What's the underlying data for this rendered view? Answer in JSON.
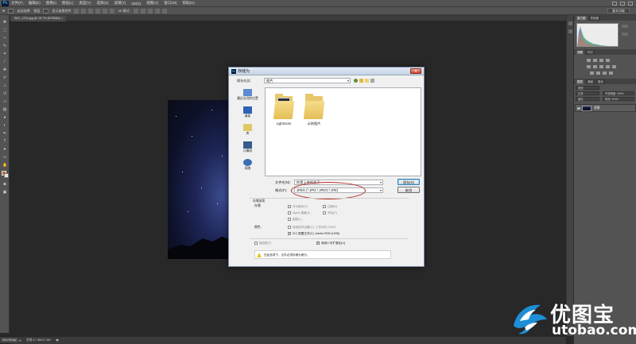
{
  "app": {
    "logo": "Ps",
    "menu": [
      "文件(F)",
      "编辑(E)",
      "图像(I)",
      "图层(L)",
      "类型(Y)",
      "选择(S)",
      "滤镜(T)",
      "3D(D)",
      "视图(V)",
      "窗口(W)",
      "帮助(H)"
    ],
    "options": {
      "auto_select": "自动选择:",
      "layer": "图层",
      "show_transform": "显示变换控件",
      "mode_3d": "3D 模式:",
      "workspace": "基本功能"
    },
    "doc_tab": "IMG_1234.jpg @ 16.7% (RGB/8#) ×"
  },
  "status": {
    "zoom": "16.67%",
    "doc": "文档:17.3M/17.3M",
    "mini_bridge": "Mini Bridge",
    "timeline": "时间轴"
  },
  "right_panel": {
    "tabs_top": [
      "直方图",
      "导航器"
    ],
    "tabs_mid": [
      "调整",
      "样式"
    ],
    "tabs_layers": [
      "图层",
      "通道",
      "路径"
    ],
    "layer_kind": "类型",
    "blend_mode": "正常",
    "opacity": "不透明度: 100%",
    "lock": "锁定:",
    "fill": "填充: 100%",
    "layer_name": "背景"
  },
  "dialog": {
    "title": "存储为",
    "save_in_label": "保存在(I):",
    "save_in_value": "图片",
    "places": [
      "最近访问的位置",
      "桌面",
      "库",
      "计算机",
      "网络"
    ],
    "folders": [
      "Lightroom",
      "示例图片"
    ],
    "filename_label": "文件名(N):",
    "filename_value": "你是上帝的孩子",
    "format_label": "格式(F):",
    "format_value": "JPEG (*.JPG;*.JPEG;*.JPE)",
    "save_button": "保存(S)",
    "cancel_button": "取消",
    "storage_title": "存储选项",
    "storage_label": "存储:",
    "opt_copy": "作为副本(Y)",
    "opt_notes": "注释(N)",
    "opt_alpha": "Alpha 通道(E)",
    "opt_spot": "专色(P)",
    "opt_layers": "图层(L)",
    "color_label": "颜色:",
    "opt_proof": "使用校样设置(O): 工作中的 CMYK",
    "opt_icc": "ICC 配置文件(C): Adobe RGB (1998)",
    "thumbnail": "缩览图(T)",
    "lowercase": "使用小写扩展名(U)",
    "warning": "在此选项下，文件必须存储为拷贝。"
  },
  "watermark": {
    "cn": "优图宝",
    "en": "utobao.com"
  },
  "colors": {
    "accent": "#31a8ff",
    "fg_swatch": "#c86a2c",
    "highlight": "#b5281c"
  }
}
